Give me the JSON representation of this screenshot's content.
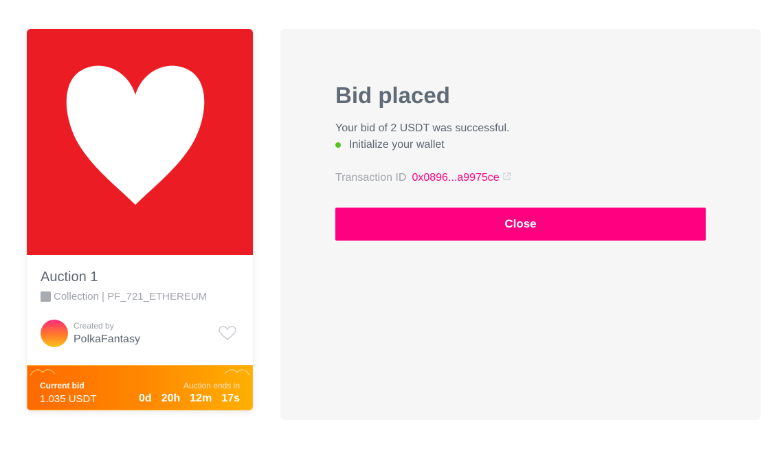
{
  "nft_card": {
    "title": "Auction 1",
    "collection": "Collection | PF_721_ETHEREUM",
    "created_by_label": "Created by",
    "creator_name": "PolkaFantasy",
    "image_color": "#ec1c24",
    "bid": {
      "current_bid_label": "Current bid",
      "current_bid_value": "1.035 USDT",
      "auction_ends_label": "Auction ends in",
      "countdown": {
        "days": "0d",
        "hours": "20h",
        "minutes": "12m",
        "seconds": "17s"
      }
    }
  },
  "modal": {
    "title": "Bid placed",
    "message": "Your bid of 2 USDT was successful.",
    "wallet_step": "Initialize your wallet",
    "transaction_label": "Transaction ID",
    "transaction_id": "0x0896...a9975ce",
    "close_label": "Close"
  },
  "colors": {
    "accent": "#ff0080",
    "success": "#52c41a",
    "bid_gradient_start": "#ff6a00",
    "bid_gradient_end": "#ffb000"
  },
  "icons": [
    "heart-image",
    "collection-icon",
    "avatar",
    "heart-outline-icon",
    "external-link-icon",
    "success-dot"
  ]
}
